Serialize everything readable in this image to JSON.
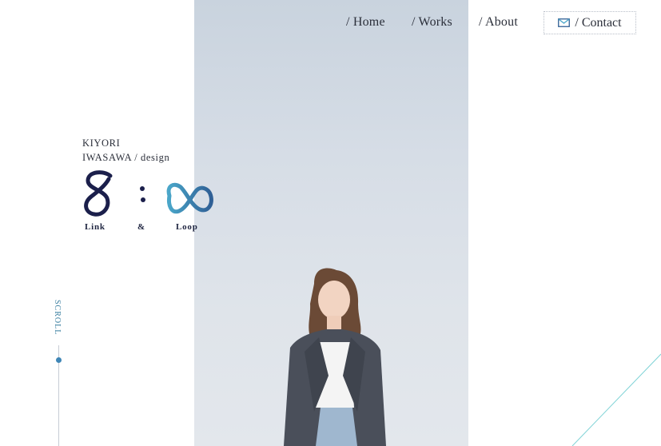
{
  "nav": {
    "items": [
      {
        "label": "/ Home"
      },
      {
        "label": "/ Works"
      },
      {
        "label": "/ About"
      }
    ],
    "contact": {
      "label": "/ Contact",
      "icon": "mail-icon"
    }
  },
  "brand": {
    "line1": "KIYORI",
    "line2": "IWASAWA / design"
  },
  "logo": {
    "captions": [
      "Link",
      "&",
      "Loop"
    ],
    "colors": {
      "eight": "#1b1f4b",
      "infinity_from": "#4aa6c9",
      "infinity_to": "#2f5f95"
    }
  },
  "scroll": {
    "label": "SCROLL"
  },
  "colors": {
    "accent": "#3f86b6",
    "diagonal": "#7fd3d6"
  }
}
